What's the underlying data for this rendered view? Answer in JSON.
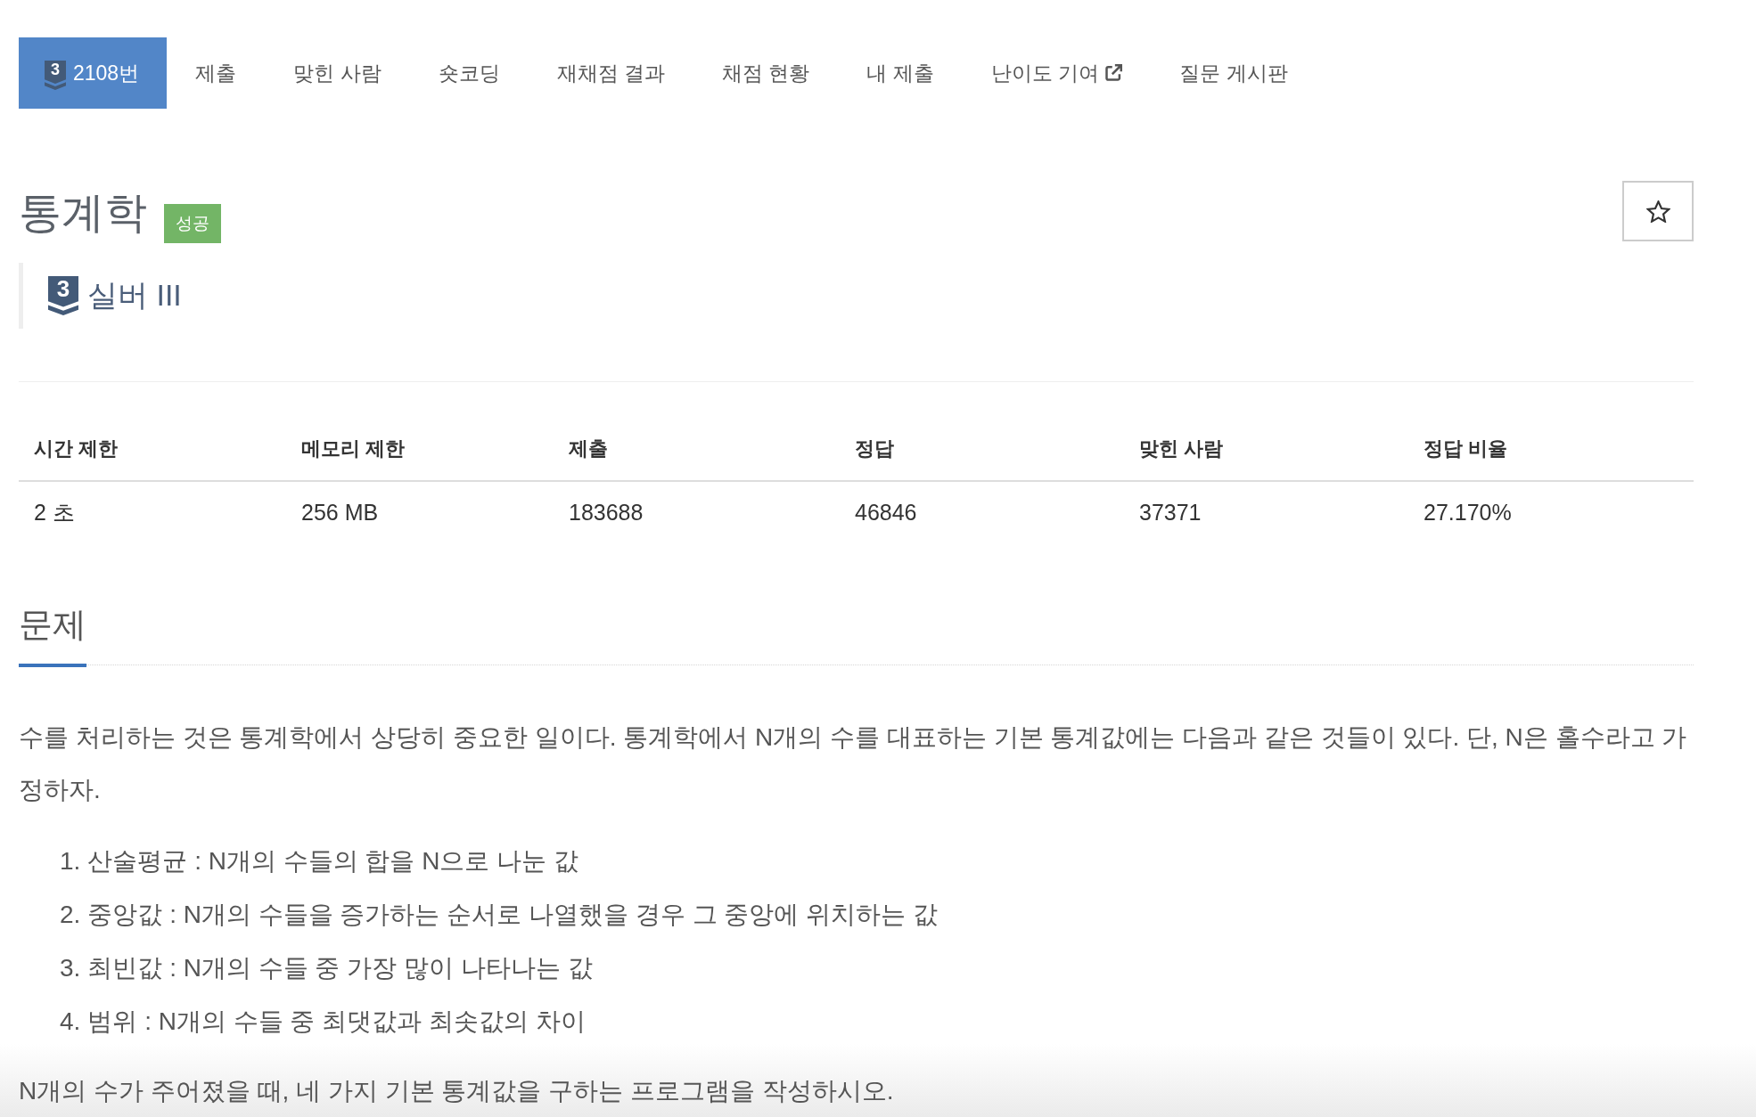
{
  "tabs": [
    {
      "label": "2108번",
      "badge": "3",
      "selected": true,
      "external": false
    },
    {
      "label": "제출",
      "selected": false,
      "external": false
    },
    {
      "label": "맞힌 사람",
      "selected": false,
      "external": false
    },
    {
      "label": "숏코딩",
      "selected": false,
      "external": false
    },
    {
      "label": "재채점 결과",
      "selected": false,
      "external": false
    },
    {
      "label": "채점 현황",
      "selected": false,
      "external": false
    },
    {
      "label": "내 제출",
      "selected": false,
      "external": false
    },
    {
      "label": "난이도 기여",
      "selected": false,
      "external": true
    },
    {
      "label": "질문 게시판",
      "selected": false,
      "external": false
    }
  ],
  "problem": {
    "title": "통계학",
    "result": "성공",
    "starred": false,
    "tier": {
      "badge": "3",
      "name": "실버 III"
    }
  },
  "table": {
    "columns": [
      "시간 제한",
      "메모리 제한",
      "제출",
      "정답",
      "맞힌 사람",
      "정답 비율"
    ],
    "rows": [
      [
        "2 초",
        "256 MB",
        "183688",
        "46846",
        "37371",
        "27.170%"
      ]
    ]
  },
  "section": {
    "heading": "문제",
    "body": [
      {
        "kind": "paragraph",
        "text": "수를 처리하는 것은 통계학에서 상당히 중요한 일이다. 통계학에서 N개의 수를 대표하는 기본 통계값에는 다음과 같은 것들이 있다. 단, N은 홀수라고 가정하자."
      },
      {
        "kind": "list",
        "items": [
          {
            "number": "1.",
            "text": "산술평균 : N개의 수들의 합을 N으로 나눈 값"
          },
          {
            "number": "2.",
            "text": "중앙값 : N개의 수들을 증가하는 순서로 나열했을 경우 그 중앙에 위치하는 값"
          },
          {
            "number": "3.",
            "text": "최빈값 : N개의 수들 중 가장 많이 나타나는 값"
          },
          {
            "number": "4.",
            "text": "범위 : N개의 수들 중 최댓값과 최솟값의 차이"
          }
        ]
      },
      {
        "kind": "paragraph",
        "text": "N개의 수가 주어졌을 때, 네 가지 기본 통계값을 구하는 프로그램을 작성하시오."
      }
    ]
  }
}
